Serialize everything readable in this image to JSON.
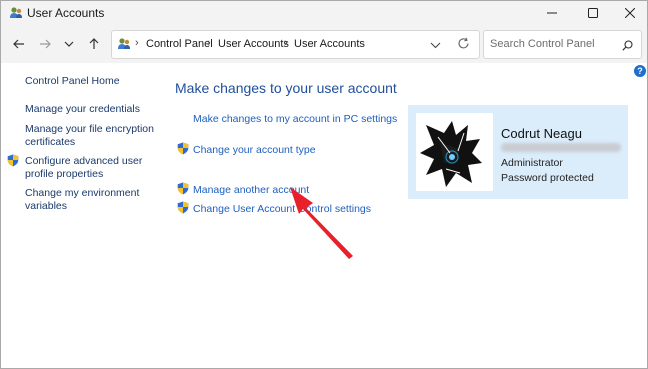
{
  "window": {
    "title": "User Accounts",
    "app_icon": "users-icon",
    "controls": [
      "minimize-icon",
      "maximize-icon",
      "close-icon"
    ]
  },
  "nav": {
    "buttons": [
      "back-arrow-icon",
      "forward-arrow-icon",
      "recent-chevron-icon",
      "up-arrow-icon"
    ],
    "breadcrumb": [
      "Control Panel",
      "User Accounts",
      "User Accounts"
    ],
    "search_placeholder": "Search Control Panel"
  },
  "sidebar": {
    "home": "Control Panel Home",
    "items": [
      {
        "lines": [
          "Manage your credentials"
        ],
        "shield": false
      },
      {
        "lines": [
          "Manage your file encryption",
          "certificates"
        ],
        "shield": false
      },
      {
        "lines": [
          "Configure advanced user",
          "profile properties"
        ],
        "shield": true
      },
      {
        "lines": [
          "Change my environment",
          "variables"
        ],
        "shield": false
      }
    ]
  },
  "main": {
    "heading": "Make changes to your user account",
    "links": [
      {
        "label": "Make changes to my account in PC settings",
        "shield": false
      },
      {
        "label": "Change your account type",
        "shield": true
      },
      {
        "label": "Manage another account",
        "shield": true
      },
      {
        "label": "Change User Account Control settings",
        "shield": true
      }
    ]
  },
  "account": {
    "name": "Codrut Neagu",
    "role": "Administrator",
    "password_status": "Password protected"
  },
  "colors": {
    "link": "#1f5fbf",
    "heading": "#1f4e9c",
    "panel_bg": "#dbedfb",
    "annotation_arrow": "#e8202a"
  }
}
